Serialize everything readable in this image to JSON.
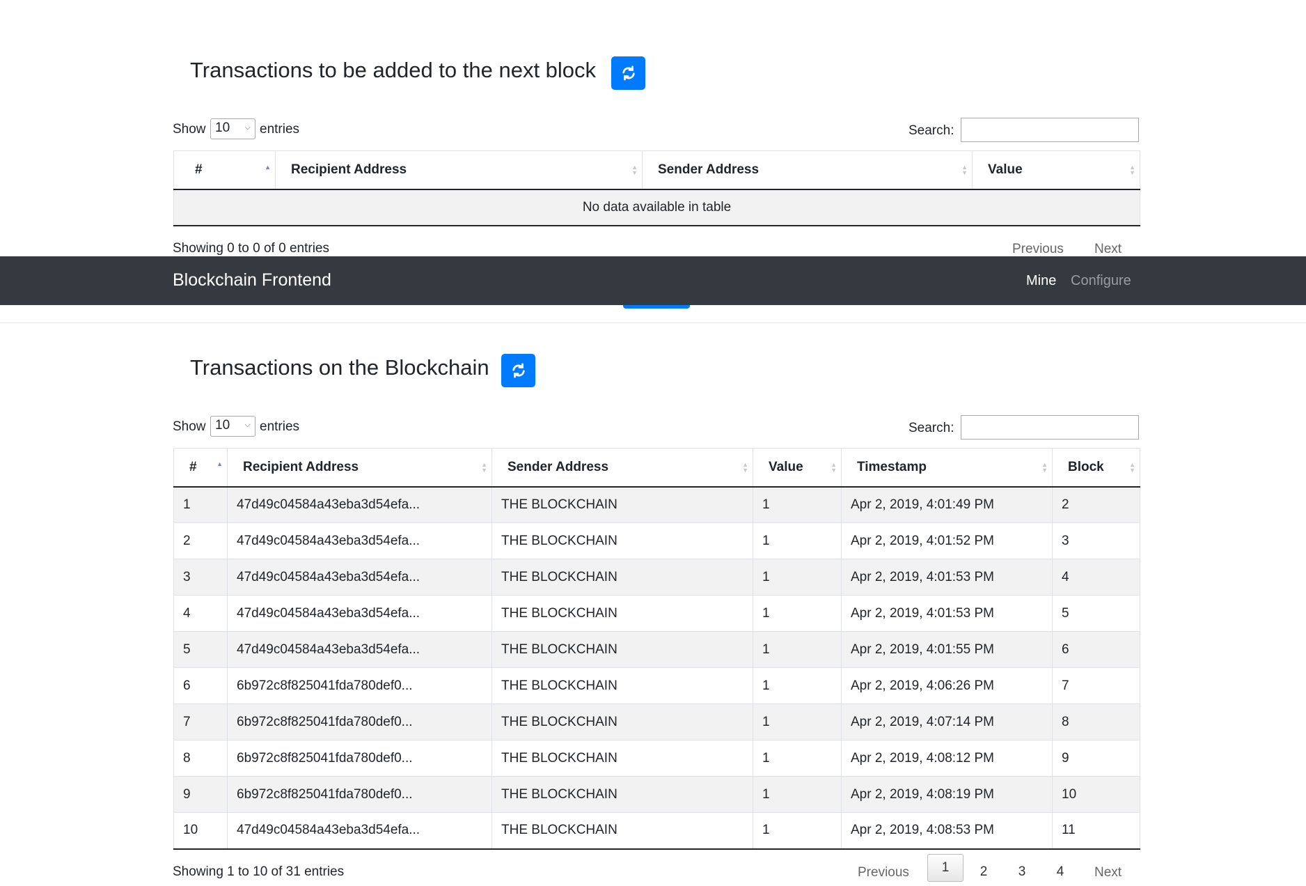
{
  "navbar": {
    "brand": "Blockchain Frontend",
    "links": [
      {
        "label": "Mine",
        "active": true
      },
      {
        "label": "Configure",
        "active": false
      }
    ]
  },
  "pending": {
    "title": "Transactions to be added to the next block",
    "length": {
      "show": "Show",
      "value": "10",
      "entries": "entries"
    },
    "search_label": "Search:",
    "search_value": "",
    "columns": [
      "#",
      "Recipient Address",
      "Sender Address",
      "Value"
    ],
    "empty_message": "No data available in table",
    "info": "Showing 0 to 0 of 0 entries",
    "previous": "Previous",
    "next": "Next"
  },
  "chain": {
    "title": "Transactions on the Blockchain",
    "length": {
      "show": "Show",
      "value": "10",
      "entries": "entries"
    },
    "search_label": "Search:",
    "search_value": "",
    "columns": [
      "#",
      "Recipient Address",
      "Sender Address",
      "Value",
      "Timestamp",
      "Block"
    ],
    "rows": [
      [
        "1",
        "47d49c04584a43eba3d54efa...",
        "THE BLOCKCHAIN",
        "1",
        "Apr 2, 2019, 4:01:49 PM",
        "2"
      ],
      [
        "2",
        "47d49c04584a43eba3d54efa...",
        "THE BLOCKCHAIN",
        "1",
        "Apr 2, 2019, 4:01:52 PM",
        "3"
      ],
      [
        "3",
        "47d49c04584a43eba3d54efa...",
        "THE BLOCKCHAIN",
        "1",
        "Apr 2, 2019, 4:01:53 PM",
        "4"
      ],
      [
        "4",
        "47d49c04584a43eba3d54efa...",
        "THE BLOCKCHAIN",
        "1",
        "Apr 2, 2019, 4:01:53 PM",
        "5"
      ],
      [
        "5",
        "47d49c04584a43eba3d54efa...",
        "THE BLOCKCHAIN",
        "1",
        "Apr 2, 2019, 4:01:55 PM",
        "6"
      ],
      [
        "6",
        "6b972c8f825041fda780def0...",
        "THE BLOCKCHAIN",
        "1",
        "Apr 2, 2019, 4:06:26 PM",
        "7"
      ],
      [
        "7",
        "6b972c8f825041fda780def0...",
        "THE BLOCKCHAIN",
        "1",
        "Apr 2, 2019, 4:07:14 PM",
        "8"
      ],
      [
        "8",
        "6b972c8f825041fda780def0...",
        "THE BLOCKCHAIN",
        "1",
        "Apr 2, 2019, 4:08:12 PM",
        "9"
      ],
      [
        "9",
        "6b972c8f825041fda780def0...",
        "THE BLOCKCHAIN",
        "1",
        "Apr 2, 2019, 4:08:19 PM",
        "10"
      ],
      [
        "10",
        "47d49c04584a43eba3d54efa...",
        "THE BLOCKCHAIN",
        "1",
        "Apr 2, 2019, 4:08:53 PM",
        "11"
      ]
    ],
    "info": "Showing 1 to 10 of 31 entries",
    "previous": "Previous",
    "pages": [
      "1",
      "2",
      "3",
      "4"
    ],
    "current_page": "1",
    "next": "Next"
  },
  "colors": {
    "primary": "#007bff",
    "navbar": "#343a40",
    "sort_active": "#7b7fd0"
  },
  "icons": {
    "refresh": "refresh-icon",
    "sort": "sort-icon"
  }
}
